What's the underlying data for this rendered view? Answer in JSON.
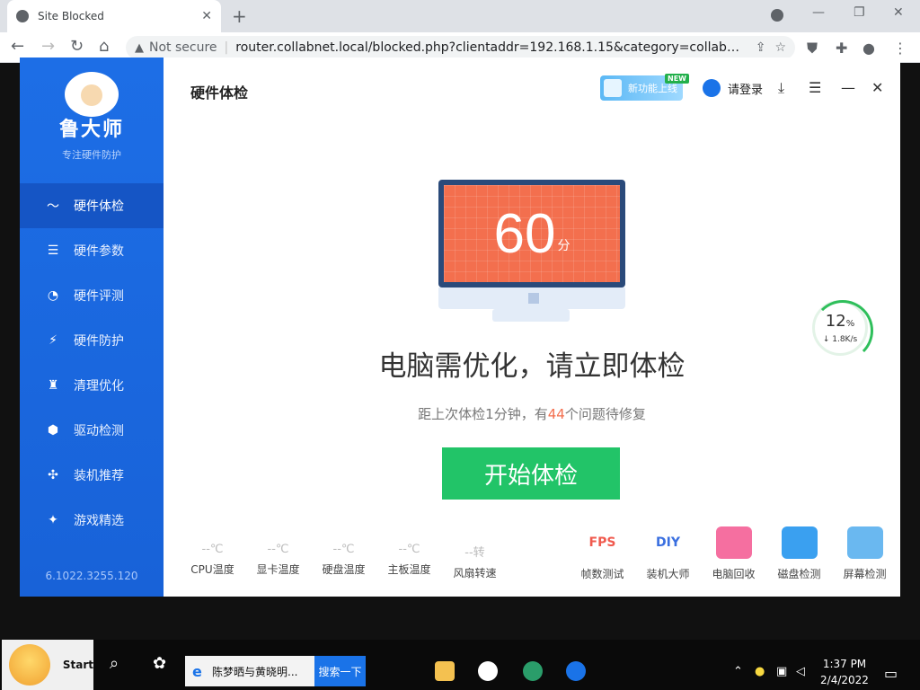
{
  "browser": {
    "tab_title": "Site Blocked",
    "tab_close": "✕",
    "new_tab": "+",
    "not_secure": "Not secure",
    "url": "router.collabnet.local/blocked.php?clientaddr=192.168.1.15&category=collabnet-malici..."
  },
  "sidebar": {
    "brand": "鲁大师",
    "slogan": "专注硬件防护",
    "items": [
      {
        "label": "硬件体检",
        "icon": "〜"
      },
      {
        "label": "硬件参数",
        "icon": "☰"
      },
      {
        "label": "硬件评测",
        "icon": "◔"
      },
      {
        "label": "硬件防护",
        "icon": "⚡"
      },
      {
        "label": "清理优化",
        "icon": "♜"
      },
      {
        "label": "驱动检测",
        "icon": "⬢"
      },
      {
        "label": "装机推荐",
        "icon": "✣"
      },
      {
        "label": "游戏精选",
        "icon": "✦"
      }
    ],
    "version": "6.1022.3255.120"
  },
  "header": {
    "title": "硬件体检",
    "new_feature": "新功能上线",
    "new_badge": "NEW",
    "login": "请登录"
  },
  "main": {
    "score": "60",
    "score_unit": "分",
    "headline": "电脑需优化，请立即体检",
    "sub_prefix": "距上次体检1分钟，有",
    "issue_count": "44",
    "sub_suffix": "个问题待修复",
    "start_button": "开始体检"
  },
  "network": {
    "percent": "12",
    "percent_unit": "%",
    "speed": "↓ 1.8K/s"
  },
  "sensors": [
    {
      "value": "--℃",
      "label": "CPU温度"
    },
    {
      "value": "--℃",
      "label": "显卡温度"
    },
    {
      "value": "--℃",
      "label": "硬盘温度"
    },
    {
      "value": "--℃",
      "label": "主板温度"
    },
    {
      "value": "--转",
      "label": "风扇转速"
    }
  ],
  "tools": [
    {
      "label": "帧数测试",
      "icon_text": "FPS",
      "color": "#f05a4e"
    },
    {
      "label": "装机大师",
      "icon_text": "DIY",
      "color": "#3a6fe0"
    },
    {
      "label": "电脑回收",
      "icon_text": "",
      "color": "#f56fa0"
    },
    {
      "label": "磁盘检测",
      "icon_text": "",
      "color": "#3aa0f0"
    },
    {
      "label": "屏幕检测",
      "icon_text": "",
      "color": "#6ab8f0"
    }
  ],
  "taskbar": {
    "start_label": "Start",
    "task_label": "陈梦晒与黄晓明...",
    "search_label": "搜索一下",
    "time": "1:37 PM",
    "date": "2/4/2022"
  },
  "colors": {
    "sidebar_blue": "#1d6ee6",
    "score_orange": "#f36f4e",
    "start_green": "#22c468"
  }
}
